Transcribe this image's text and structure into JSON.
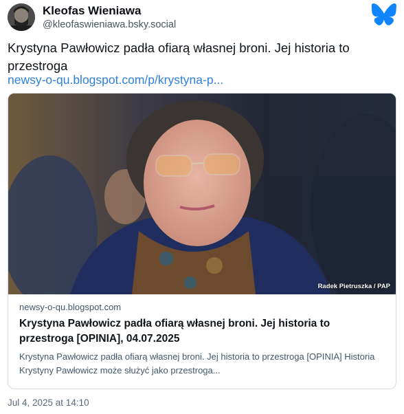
{
  "author": {
    "display_name": "Kleofas Wieniawa",
    "handle": "@kleofaswieniawa.bsky.social"
  },
  "brand_icon": "butterfly-icon",
  "post": {
    "text": "Krystyna Pawłowicz padła ofiarą własnej broni. Jej historia to przestroga",
    "link_text": "newsy-o-qu.blogspot.com/p/krystyna-p...",
    "timestamp": "Jul 4, 2025 at 14:10"
  },
  "embed": {
    "image_credit": "Radek Pietruszka / PAP",
    "domain": "newsy-o-qu.blogspot.com",
    "title": "Krystyna Pawłowicz padła ofiarą własnej broni. Jej historia to przestroga [OPINIA], 04.07.2025",
    "description": "Krystyna Pawłowicz padła ofiarą własnej broni. Jej historia to przestroga [OPINIA] Historia Krystyny Pawłowicz może służyć jako przestroga..."
  },
  "colors": {
    "link": "#2f7fe0",
    "brand_blue": "#1185fe",
    "muted": "#42576c",
    "border": "#d4dbe2"
  }
}
